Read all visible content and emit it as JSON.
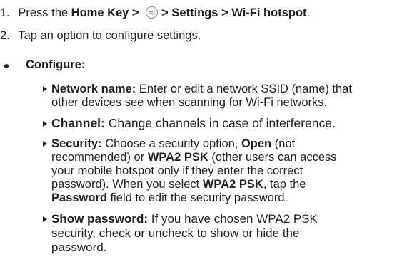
{
  "steps": [
    {
      "num": "1.",
      "pre": "Press the ",
      "b1": "Home Key >",
      "b2": "> Settings > Wi-Fi hotspot",
      "post": "."
    },
    {
      "num": "2.",
      "text": "Tap an option to configure settings."
    }
  ],
  "configure_label": "Configure:",
  "icons": {
    "apps": "apps-grid-icon"
  },
  "options": [
    {
      "label": "Network name:",
      "lines": [
        " Enter or edit a network SSID (name) that",
        "other devices see when scanning for Wi-Fi networks."
      ]
    },
    {
      "label": "Channel:",
      "lines": [
        " Change channels in case of interference."
      ]
    },
    {
      "label": "Security:",
      "l1a": " Choose a security option, ",
      "l1b": "Open",
      "l1c": " (not",
      "l2a": "recommended) or ",
      "l2b": "WPA2 PSK",
      "l2c": " (other users can access",
      "l3": "your mobile hotspot only if they enter the correct",
      "l4a": "password). When you select ",
      "l4b": "WPA2 PSK",
      "l4c": ", tap the",
      "l5a": "Password",
      "l5b": " field to edit the security password."
    },
    {
      "label": "Show password:",
      "lines": [
        " If you have chosen WPA2 PSK",
        "security, check or uncheck to show or hide the",
        "password."
      ]
    }
  ]
}
